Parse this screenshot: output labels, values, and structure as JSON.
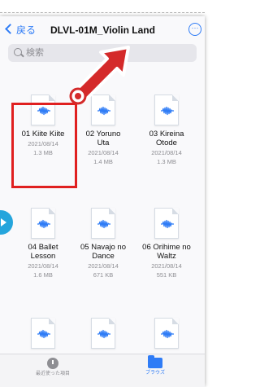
{
  "nav": {
    "back_label": "戻る",
    "title": "DLVL-01M_Violin Land",
    "more_icon": "ellipsis-circle-icon"
  },
  "search": {
    "placeholder": "検索",
    "value": ""
  },
  "files": [
    {
      "name": [
        "01 Kiite Kiite"
      ],
      "date": "2021/08/14",
      "size": "1.3 MB",
      "icon": "audio-file-icon"
    },
    {
      "name": [
        "02 Yoruno",
        "Uta"
      ],
      "date": "2021/08/14",
      "size": "1.4 MB",
      "icon": "audio-file-icon"
    },
    {
      "name": [
        "03 Kireina",
        "Otode"
      ],
      "date": "2021/08/14",
      "size": "1.3 MB",
      "icon": "audio-file-icon"
    },
    {
      "name": [
        "04 Ballet",
        "Lesson"
      ],
      "date": "2021/08/14",
      "size": "1.6 MB",
      "icon": "audio-file-icon"
    },
    {
      "name": [
        "05 Navajo no",
        "Dance"
      ],
      "date": "2021/08/14",
      "size": "671 KB",
      "icon": "audio-file-icon"
    },
    {
      "name": [
        "06 Orihime no",
        "Waltz"
      ],
      "date": "2021/08/14",
      "size": "551 KB",
      "icon": "audio-file-icon"
    },
    {
      "icon": "audio-file-icon"
    },
    {
      "icon": "audio-file-icon"
    },
    {
      "icon": "audio-file-icon"
    }
  ],
  "tabbar": {
    "recents_label": "最近使った項目",
    "browse_label": "ブラウズ"
  },
  "colors": {
    "accent": "#2f7cf6",
    "highlight": "#e02020",
    "side_marker": "#25a5dc"
  }
}
